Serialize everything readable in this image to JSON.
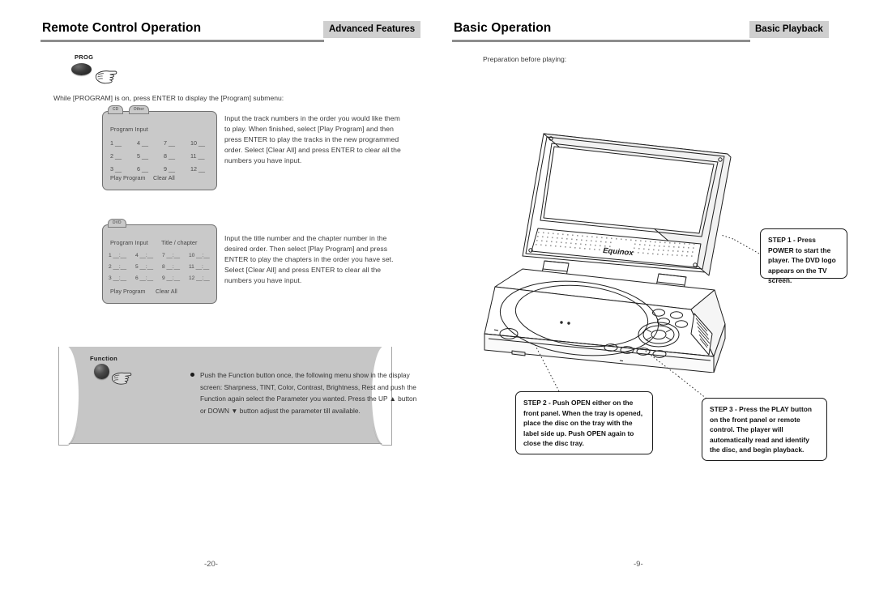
{
  "left_page": {
    "header": {
      "title": "Remote Control Operation",
      "badge": "Advanced Features"
    },
    "prog_button": {
      "label": "PROG",
      "icon": "oval-remote-button",
      "hand_icon": "pointing-hand-icon"
    },
    "intro_text": "While [PROGRAM] is on, press ENTER to display the [Program] submenu:",
    "osd_cd": {
      "tabs": [
        "CD",
        "Other"
      ],
      "title": "Program Input",
      "entries": [
        "1 __",
        "4 __",
        "7 __",
        "10 __",
        "2 __",
        "5 __",
        "8 __",
        "11 __",
        "3 __",
        "6 __",
        "9 __",
        "12 __"
      ],
      "footer_play": "Play Program",
      "footer_clear": "Clear All",
      "description": "Input the track numbers in the order you would like them to play. When finished, select [Play Program] and then press ENTER to play the tracks in the new programmed order. Select [Clear All] and press ENTER to clear all the numbers you have input."
    },
    "osd_dvd": {
      "tabs": [
        "DVD"
      ],
      "title": "Program Input",
      "subtitle": "Title / chapter",
      "entries": [
        "1 __:__",
        "4 __:__",
        "7 __:__",
        "10 __:__",
        "2 __:__",
        "5 __:__",
        "8 __:__",
        "11 __:__",
        "3 __:__",
        "6 __:__",
        "9 __:__",
        "12 __:__"
      ],
      "footer_play": "Play Program",
      "footer_clear": "Clear All",
      "description": "Input the title number and the chapter number in the desired order. Then select [Play Program] and press ENTER to play the chapters in the order you have set. Select [Clear All] and press ENTER to clear all the numbers you have input."
    },
    "function_panel": {
      "label": "Function",
      "icon": "round-remote-button",
      "hand_icon": "pointing-hand-icon",
      "text": "Push the Function button once, the following menu show in the display screen: Sharpness, TINT, Color,  Contrast, Brightness, Rest and push the  Function again select the  Parameter you wanted. Press the UP ▲ button or DOWN ▼ button  adjust the parameter till available."
    },
    "page_number": "-20-"
  },
  "right_page": {
    "header": {
      "title": "Basic Operation",
      "badge": "Basic Playback"
    },
    "intro_text": "Preparation before playing:",
    "device": {
      "name": "portable-dvd-player-illustration",
      "brand": "Equinox"
    },
    "callouts": [
      {
        "id": "step-1",
        "text": "STEP 1 - Press POWER to start the player. The DVD logo appears on the TV screen."
      },
      {
        "id": "step-2",
        "text": "STEP 2 - Push OPEN either on the front panel. When the tray is opened, place the disc on the tray with the label side up. Push OPEN  again to close the disc tray."
      },
      {
        "id": "step-3",
        "text": "STEP 3 - Press the PLAY button on the front panel or remote control. The player will automatically read and identify the disc, and begin playback."
      }
    ],
    "page_number": "-9-"
  },
  "colors": {
    "header_rule": "#8d8d8d",
    "badge_bg": "#cfcfcf",
    "osd_bg": "#c9c9c9",
    "banner_bg": "#c6c6c6",
    "text": "#3a3a3a"
  }
}
